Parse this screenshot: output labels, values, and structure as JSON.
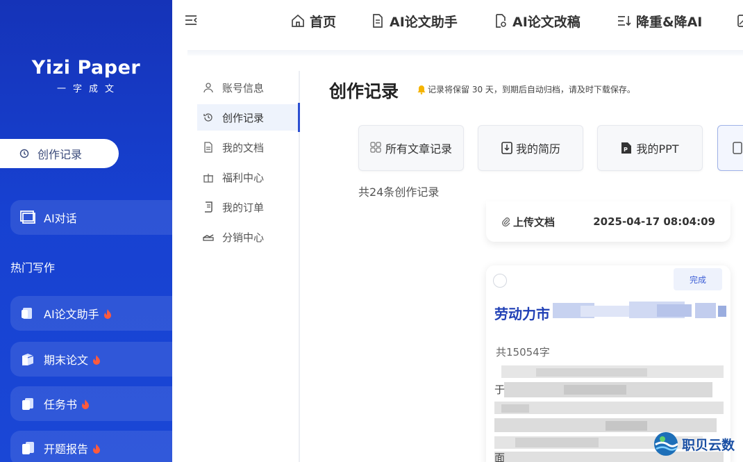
{
  "brand": {
    "name": "Yizi Paper",
    "subtitle": "一字成文"
  },
  "sidebar": {
    "active_item": "创作记录",
    "chat_label": "AI对话",
    "hot_section_label": "热门写作",
    "hot_items": [
      {
        "label": "AI论文助手",
        "icon": "paper-assistant-icon",
        "hot": true
      },
      {
        "label": "期末论文",
        "icon": "final-paper-icon",
        "hot": true
      },
      {
        "label": "任务书",
        "icon": "task-book-icon",
        "hot": true
      },
      {
        "label": "开题报告",
        "icon": "proposal-report-icon",
        "hot": true
      }
    ]
  },
  "topnav": {
    "items": [
      {
        "label": "首页",
        "icon": "home-icon"
      },
      {
        "label": "AI论文助手",
        "icon": "document-icon"
      },
      {
        "label": "AI论文改稿",
        "icon": "edit-document-icon"
      },
      {
        "label": "降重&降AI",
        "icon": "sort-down-icon"
      }
    ]
  },
  "submenu": {
    "items": [
      {
        "label": "账号信息",
        "icon": "user-icon",
        "active": false
      },
      {
        "label": "创作记录",
        "icon": "history-icon",
        "active": true
      },
      {
        "label": "我的文档",
        "icon": "document-icon",
        "active": false
      },
      {
        "label": "福利中心",
        "icon": "gift-icon",
        "active": false
      },
      {
        "label": "我的订单",
        "icon": "order-icon",
        "active": false
      },
      {
        "label": "分销中心",
        "icon": "distribution-icon",
        "active": false
      }
    ]
  },
  "main": {
    "title": "创作记录",
    "notice": "记录将保留 30 天，到期后自动归档，请及时下载保存。",
    "categories": [
      {
        "label": "所有文章记录",
        "icon": "grid-icon"
      },
      {
        "label": "我的简历",
        "icon": "resume-icon"
      },
      {
        "label": "我的PPT",
        "icon": "ppt-icon"
      }
    ],
    "record_count": "共24条创作记录",
    "records": [
      {
        "type_label": "上传文档",
        "time": "2025-04-17 08:04:09"
      },
      {
        "status": "完成",
        "title": "劳动力市",
        "word_count": "共15054字",
        "excerpt_start": "于",
        "excerpt_end": "面"
      }
    ]
  },
  "watermark": {
    "text": "职贝云数"
  },
  "colors": {
    "sidebar": "#1741d1",
    "accent": "#2b4ed1",
    "title_blue": "#1f3fb5",
    "hot": "#ff5a3c"
  }
}
